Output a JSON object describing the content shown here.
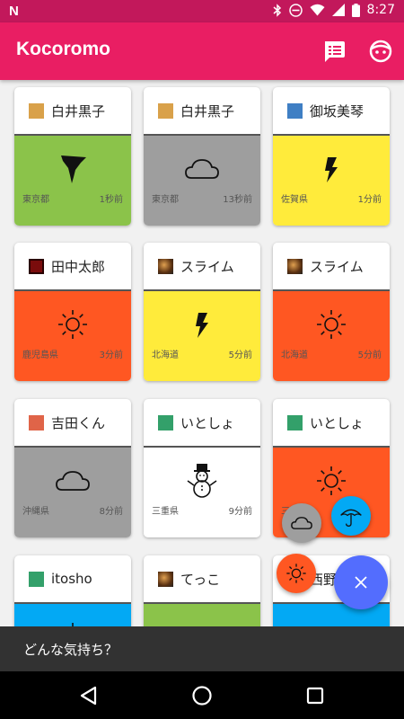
{
  "status_bar": {
    "time": "8:27",
    "icons": [
      "notification-n-icon",
      "bluetooth-icon",
      "do-not-disturb-icon",
      "wifi-icon",
      "signal-icon",
      "battery-icon"
    ]
  },
  "app_bar": {
    "title": "Kocoromo",
    "actions": [
      "feed-icon",
      "face-icon"
    ]
  },
  "colors": {
    "primary": "#e91e63",
    "primary_dark": "#c2185b",
    "accent": "#536dfe",
    "weather_green": "#8bc34a",
    "weather_gray": "#9e9e9e",
    "weather_yellow": "#ffeb3b",
    "weather_orange": "#ff5722",
    "weather_blue": "#03a9f4",
    "weather_white": "#ffffff"
  },
  "cards": [
    {
      "name": "白井黒子",
      "avatar": "orange-square",
      "weather": "tornado-icon",
      "location": "東京都",
      "time": "1秒前"
    },
    {
      "name": "白井黒子",
      "avatar": "orange-square",
      "weather": "cloud-icon",
      "location": "東京都",
      "time": "13秒前"
    },
    {
      "name": "御坂美琴",
      "avatar": "blue-square",
      "weather": "lightning-icon",
      "location": "佐賀県",
      "time": "1分前"
    },
    {
      "name": "田中太郎",
      "avatar": "dark-red-photo",
      "weather": "sun-icon",
      "location": "鹿児島県",
      "time": "3分前"
    },
    {
      "name": "スライム",
      "avatar": "food-photo",
      "weather": "lightning-icon",
      "location": "北海道",
      "time": "5分前"
    },
    {
      "name": "スライム",
      "avatar": "food-photo",
      "weather": "sun-icon",
      "location": "北海道",
      "time": "5分前"
    },
    {
      "name": "吉田くん",
      "avatar": "coral-square",
      "weather": "cloud-icon",
      "location": "沖縄県",
      "time": "8分前"
    },
    {
      "name": "いとしょ",
      "avatar": "green-square",
      "weather": "snowman-icon",
      "location": "三重県",
      "time": "9分前"
    },
    {
      "name": "いとしょ",
      "avatar": "green-square",
      "weather": "sun-icon",
      "location": "三重県",
      "time": ""
    },
    {
      "name": "itosho",
      "avatar": "green-square",
      "weather": "sun-icon",
      "location": "",
      "time": ""
    },
    {
      "name": "てっこ",
      "avatar": "food-photo",
      "weather": "",
      "location": "",
      "time": ""
    },
    {
      "name": "西野",
      "avatar": "orange-square",
      "weather": "",
      "location": "",
      "time": ""
    }
  ],
  "fab_menu": {
    "options": [
      "cloud-icon",
      "umbrella-icon",
      "sun-icon"
    ],
    "close": "close-icon"
  },
  "snackbar": {
    "message": "どんな気持ち？"
  },
  "nav_bar": {
    "buttons": [
      "back-icon",
      "home-icon",
      "recents-icon"
    ]
  }
}
